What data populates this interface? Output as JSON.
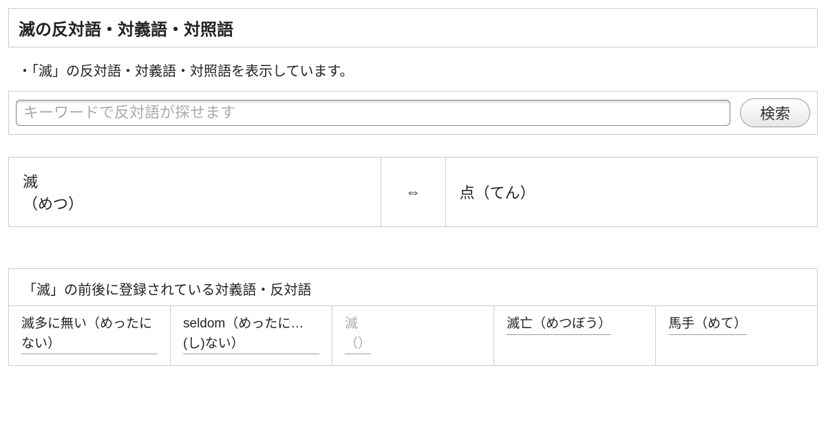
{
  "header": {
    "title": "滅の反対語・対義語・対照語"
  },
  "intro": "・「滅」の反対語・対義語・対照語を表示しています。",
  "search": {
    "placeholder": "キーワードで反対語が探せます",
    "button_label": "検索"
  },
  "pair": {
    "left_term": "滅",
    "left_reading": "（めつ）",
    "arrow": "⇔",
    "right_term": "点（てん）"
  },
  "related": {
    "title": "「滅」の前後に登録されている対義語・反対語",
    "items": [
      {
        "label": "滅多に無い（めったにない）",
        "muted": false
      },
      {
        "label": "seldom（めったに…(し)ない）",
        "muted": false
      },
      {
        "label": "滅",
        "paren": "（）",
        "muted": true
      },
      {
        "label": "滅亡（めつぼう）",
        "muted": false
      },
      {
        "label": "馬手（めて）",
        "muted": false
      }
    ]
  }
}
